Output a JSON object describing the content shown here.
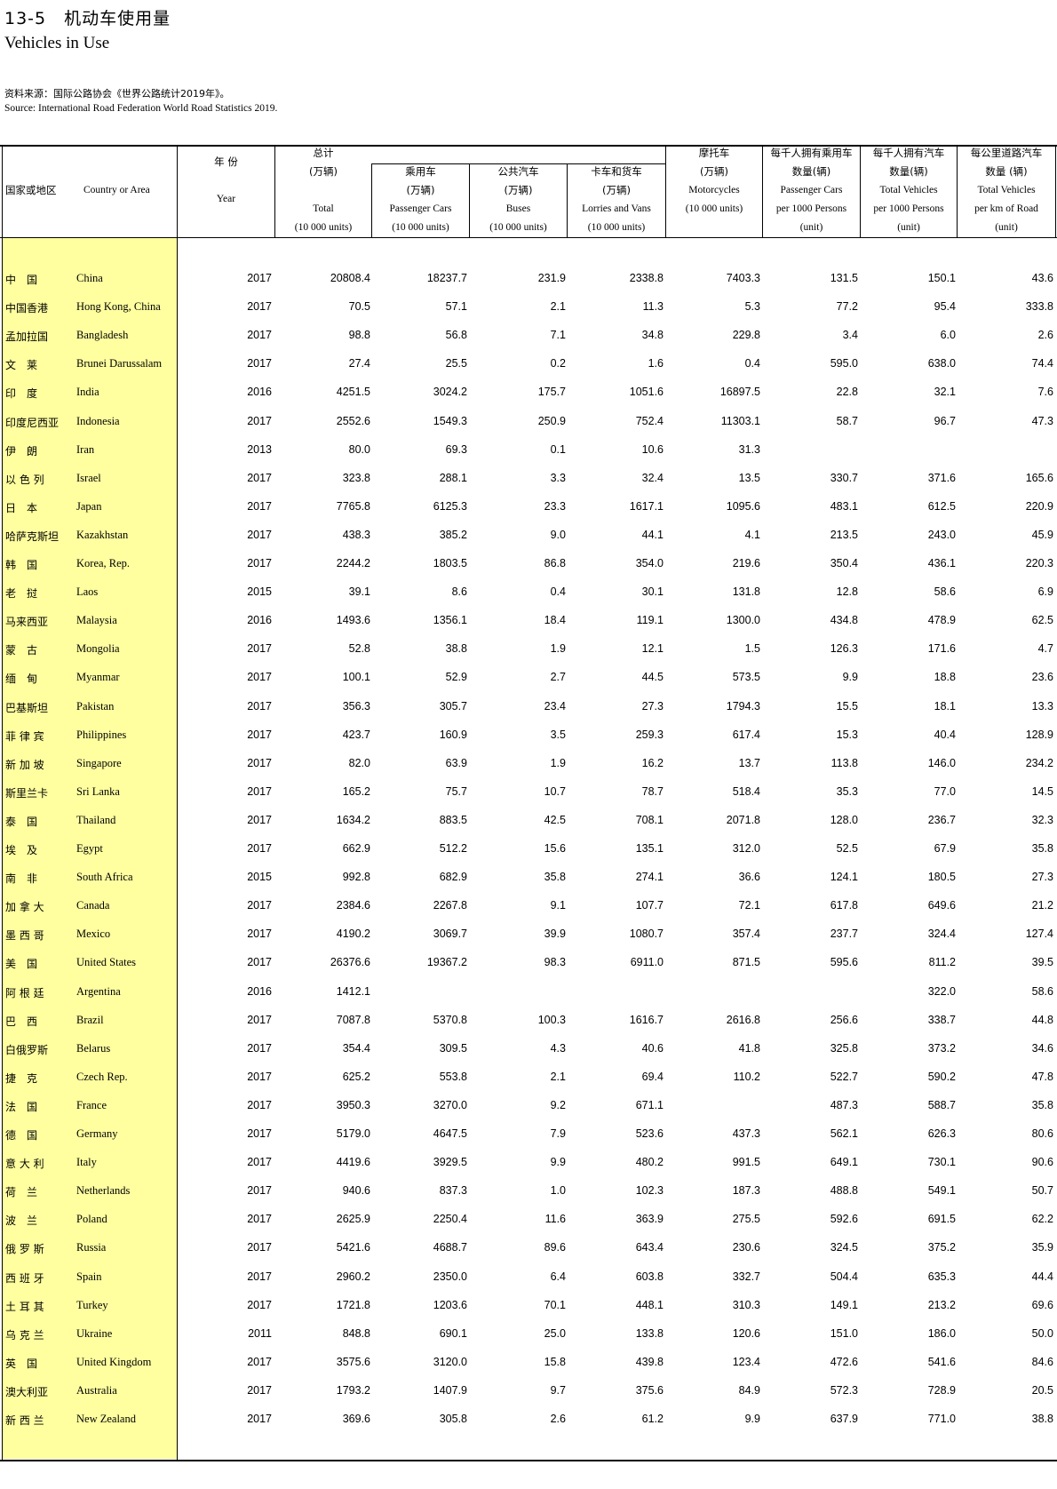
{
  "title_cn": "13-5　机动车使用量",
  "title_en": "Vehicles in Use",
  "source_cn": "资料来源：国际公路协会《世界公路统计2019年》。",
  "source_en": "Source:  International Road Federation World Road Statistics 2019.",
  "headers": {
    "country_cn": "国家或地区",
    "country_en": "Country or Area",
    "year_cn": "年 份",
    "year_en": "Year",
    "total_cn": "总计",
    "total_unit_cn": "(万辆)",
    "total_en": "Total",
    "total_unit_en": "(10 000 units)",
    "pass_cn": "乘用车",
    "pass_unit_cn": "(万辆)",
    "pass_en": "Passenger Cars",
    "pass_unit_en": "(10 000 units)",
    "bus_cn": "公共汽车",
    "bus_unit_cn": "(万辆)",
    "bus_en": "Buses",
    "bus_unit_en": "(10 000 units)",
    "lorry_cn": "卡车和货车",
    "lorry_unit_cn": "(万辆)",
    "lorry_en": "Lorries and Vans",
    "lorry_unit_en": "(10 000 units)",
    "moto_cn": "摩托车",
    "moto_unit_cn": "(万辆)",
    "moto_en": "Motorcycles",
    "moto_unit_en": "(10 000 units)",
    "pcar_cn1": "每千人拥有乘用车",
    "pcar_cn2": "数量(辆)",
    "pcar_en1": "Passenger Cars",
    "pcar_en2": "per 1000 Persons",
    "pcar_unit": "(unit)",
    "tveh_cn1": "每千人拥有汽车",
    "tveh_cn2": "数量(辆)",
    "tveh_en1": "Total Vehicles",
    "tveh_en2": "per 1000 Persons",
    "tveh_unit": "(unit)",
    "perkm_cn1": "每公里道路汽车",
    "perkm_cn2": "数量 (辆)",
    "perkm_en1": "Total Vehicles",
    "perkm_en2": "per km of Road",
    "perkm_unit": "(unit)"
  },
  "rows": [
    {
      "cn": "中　国",
      "en": "China",
      "year": "2017",
      "total": "20808.4",
      "pass": "18237.7",
      "bus": "231.9",
      "lorry": "2338.8",
      "moto": "7403.3",
      "pcar": "131.5",
      "tveh": "150.1",
      "perkm": "43.6"
    },
    {
      "cn": "中国香港",
      "en": "Hong Kong, China",
      "year": "2017",
      "total": "70.5",
      "pass": "57.1",
      "bus": "2.1",
      "lorry": "11.3",
      "moto": "5.3",
      "pcar": "77.2",
      "tveh": "95.4",
      "perkm": "333.8"
    },
    {
      "cn": "孟加拉国",
      "en": "Bangladesh",
      "year": "2017",
      "total": "98.8",
      "pass": "56.8",
      "bus": "7.1",
      "lorry": "34.8",
      "moto": "229.8",
      "pcar": "3.4",
      "tveh": "6.0",
      "perkm": "2.6"
    },
    {
      "cn": "文　莱",
      "en": "Brunei Darussalam",
      "year": "2017",
      "total": "27.4",
      "pass": "25.5",
      "bus": "0.2",
      "lorry": "1.6",
      "moto": "0.4",
      "pcar": "595.0",
      "tveh": "638.0",
      "perkm": "74.4"
    },
    {
      "cn": "印　度",
      "en": "India",
      "year": "2016",
      "total": "4251.5",
      "pass": "3024.2",
      "bus": "175.7",
      "lorry": "1051.6",
      "moto": "16897.5",
      "pcar": "22.8",
      "tveh": "32.1",
      "perkm": "7.6"
    },
    {
      "cn": "印度尼西亚",
      "en": "Indonesia",
      "year": "2017",
      "total": "2552.6",
      "pass": "1549.3",
      "bus": "250.9",
      "lorry": "752.4",
      "moto": "11303.1",
      "pcar": "58.7",
      "tveh": "96.7",
      "perkm": "47.3"
    },
    {
      "cn": "伊　朗",
      "en": "Iran",
      "year": "2013",
      "total": "80.0",
      "pass": "69.3",
      "bus": "0.1",
      "lorry": "10.6",
      "moto": "31.3",
      "pcar": "",
      "tveh": "",
      "perkm": ""
    },
    {
      "cn": "以 色 列",
      "en": "Israel",
      "year": "2017",
      "total": "323.8",
      "pass": "288.1",
      "bus": "3.3",
      "lorry": "32.4",
      "moto": "13.5",
      "pcar": "330.7",
      "tveh": "371.6",
      "perkm": "165.6"
    },
    {
      "cn": "日　本",
      "en": "Japan",
      "year": "2017",
      "total": "7765.8",
      "pass": "6125.3",
      "bus": "23.3",
      "lorry": "1617.1",
      "moto": "1095.6",
      "pcar": "483.1",
      "tveh": "612.5",
      "perkm": "220.9"
    },
    {
      "cn": "哈萨克斯坦",
      "en": "Kazakhstan",
      "year": "2017",
      "total": "438.3",
      "pass": "385.2",
      "bus": "9.0",
      "lorry": "44.1",
      "moto": "4.1",
      "pcar": "213.5",
      "tveh": "243.0",
      "perkm": "45.9"
    },
    {
      "cn": "韩　国",
      "en": "Korea, Rep.",
      "year": "2017",
      "total": "2244.2",
      "pass": "1803.5",
      "bus": "86.8",
      "lorry": "354.0",
      "moto": "219.6",
      "pcar": "350.4",
      "tveh": "436.1",
      "perkm": "220.3"
    },
    {
      "cn": "老　挝",
      "en": "Laos",
      "year": "2015",
      "total": "39.1",
      "pass": "8.6",
      "bus": "0.4",
      "lorry": "30.1",
      "moto": "131.8",
      "pcar": "12.8",
      "tveh": "58.6",
      "perkm": "6.9"
    },
    {
      "cn": "马来西亚",
      "en": "Malaysia",
      "year": "2016",
      "total": "1493.6",
      "pass": "1356.1",
      "bus": "18.4",
      "lorry": "119.1",
      "moto": "1300.0",
      "pcar": "434.8",
      "tveh": "478.9",
      "perkm": "62.5"
    },
    {
      "cn": "蒙　古",
      "en": "Mongolia",
      "year": "2017",
      "total": "52.8",
      "pass": "38.8",
      "bus": "1.9",
      "lorry": "12.1",
      "moto": "1.5",
      "pcar": "126.3",
      "tveh": "171.6",
      "perkm": "4.7"
    },
    {
      "cn": "缅　甸",
      "en": "Myanmar",
      "year": "2017",
      "total": "100.1",
      "pass": "52.9",
      "bus": "2.7",
      "lorry": "44.5",
      "moto": "573.5",
      "pcar": "9.9",
      "tveh": "18.8",
      "perkm": "23.6"
    },
    {
      "cn": "巴基斯坦",
      "en": "Pakistan",
      "year": "2017",
      "total": "356.3",
      "pass": "305.7",
      "bus": "23.4",
      "lorry": "27.3",
      "moto": "1794.3",
      "pcar": "15.5",
      "tveh": "18.1",
      "perkm": "13.3"
    },
    {
      "cn": "菲 律 宾",
      "en": "Philippines",
      "year": "2017",
      "total": "423.7",
      "pass": "160.9",
      "bus": "3.5",
      "lorry": "259.3",
      "moto": "617.4",
      "pcar": "15.3",
      "tveh": "40.4",
      "perkm": "128.9"
    },
    {
      "cn": "新 加 坡",
      "en": "Singapore",
      "year": "2017",
      "total": "82.0",
      "pass": "63.9",
      "bus": "1.9",
      "lorry": "16.2",
      "moto": "13.7",
      "pcar": "113.8",
      "tveh": "146.0",
      "perkm": "234.2"
    },
    {
      "cn": "斯里兰卡",
      "en": "Sri Lanka",
      "year": "2017",
      "total": "165.2",
      "pass": "75.7",
      "bus": "10.7",
      "lorry": "78.7",
      "moto": "518.4",
      "pcar": "35.3",
      "tveh": "77.0",
      "perkm": "14.5"
    },
    {
      "cn": "泰　国",
      "en": "Thailand",
      "year": "2017",
      "total": "1634.2",
      "pass": "883.5",
      "bus": "42.5",
      "lorry": "708.1",
      "moto": "2071.8",
      "pcar": "128.0",
      "tveh": "236.7",
      "perkm": "32.3"
    },
    {
      "cn": "埃　及",
      "en": "Egypt",
      "year": "2017",
      "total": "662.9",
      "pass": "512.2",
      "bus": "15.6",
      "lorry": "135.1",
      "moto": "312.0",
      "pcar": "52.5",
      "tveh": "67.9",
      "perkm": "35.8"
    },
    {
      "cn": "南　非",
      "en": "South Africa",
      "year": "2015",
      "total": "992.8",
      "pass": "682.9",
      "bus": "35.8",
      "lorry": "274.1",
      "moto": "36.6",
      "pcar": "124.1",
      "tveh": "180.5",
      "perkm": "27.3"
    },
    {
      "cn": "加 拿 大",
      "en": "Canada",
      "year": "2017",
      "total": "2384.6",
      "pass": "2267.8",
      "bus": "9.1",
      "lorry": "107.7",
      "moto": "72.1",
      "pcar": "617.8",
      "tveh": "649.6",
      "perkm": "21.2"
    },
    {
      "cn": "墨 西 哥",
      "en": "Mexico",
      "year": "2017",
      "total": "4190.2",
      "pass": "3069.7",
      "bus": "39.9",
      "lorry": "1080.7",
      "moto": "357.4",
      "pcar": "237.7",
      "tveh": "324.4",
      "perkm": "127.4"
    },
    {
      "cn": "美　国",
      "en": "United States",
      "year": "2017",
      "total": "26376.6",
      "pass": "19367.2",
      "bus": "98.3",
      "lorry": "6911.0",
      "moto": "871.5",
      "pcar": "595.6",
      "tveh": "811.2",
      "perkm": "39.5"
    },
    {
      "cn": "阿 根 廷",
      "en": "Argentina",
      "year": "2016",
      "total": "1412.1",
      "pass": "",
      "bus": "",
      "lorry": "",
      "moto": "",
      "pcar": "",
      "tveh": "322.0",
      "perkm": "58.6"
    },
    {
      "cn": "巴　西",
      "en": "Brazil",
      "year": "2017",
      "total": "7087.8",
      "pass": "5370.8",
      "bus": "100.3",
      "lorry": "1616.7",
      "moto": "2616.8",
      "pcar": "256.6",
      "tveh": "338.7",
      "perkm": "44.8"
    },
    {
      "cn": "白俄罗斯",
      "en": "Belarus",
      "year": "2017",
      "total": "354.4",
      "pass": "309.5",
      "bus": "4.3",
      "lorry": "40.6",
      "moto": "41.8",
      "pcar": "325.8",
      "tveh": "373.2",
      "perkm": "34.6"
    },
    {
      "cn": "捷　克",
      "en": "Czech Rep.",
      "year": "2017",
      "total": "625.2",
      "pass": "553.8",
      "bus": "2.1",
      "lorry": "69.4",
      "moto": "110.2",
      "pcar": "522.7",
      "tveh": "590.2",
      "perkm": "47.8"
    },
    {
      "cn": "法　国",
      "en": "France",
      "year": "2017",
      "total": "3950.3",
      "pass": "3270.0",
      "bus": "9.2",
      "lorry": "671.1",
      "moto": "",
      "pcar": "487.3",
      "tveh": "588.7",
      "perkm": "35.8"
    },
    {
      "cn": "德　国",
      "en": "Germany",
      "year": "2017",
      "total": "5179.0",
      "pass": "4647.5",
      "bus": "7.9",
      "lorry": "523.6",
      "moto": "437.3",
      "pcar": "562.1",
      "tveh": "626.3",
      "perkm": "80.6"
    },
    {
      "cn": "意 大 利",
      "en": "Italy",
      "year": "2017",
      "total": "4419.6",
      "pass": "3929.5",
      "bus": "9.9",
      "lorry": "480.2",
      "moto": "991.5",
      "pcar": "649.1",
      "tveh": "730.1",
      "perkm": "90.6"
    },
    {
      "cn": "荷　兰",
      "en": "Netherlands",
      "year": "2017",
      "total": "940.6",
      "pass": "837.3",
      "bus": "1.0",
      "lorry": "102.3",
      "moto": "187.3",
      "pcar": "488.8",
      "tveh": "549.1",
      "perkm": "50.7"
    },
    {
      "cn": "波　兰",
      "en": "Poland",
      "year": "2017",
      "total": "2625.9",
      "pass": "2250.4",
      "bus": "11.6",
      "lorry": "363.9",
      "moto": "275.5",
      "pcar": "592.6",
      "tveh": "691.5",
      "perkm": "62.2"
    },
    {
      "cn": "俄 罗 斯",
      "en": "Russia",
      "year": "2017",
      "total": "5421.6",
      "pass": "4688.7",
      "bus": "89.6",
      "lorry": "643.4",
      "moto": "230.6",
      "pcar": "324.5",
      "tveh": "375.2",
      "perkm": "35.9"
    },
    {
      "cn": "西 班 牙",
      "en": "Spain",
      "year": "2017",
      "total": "2960.2",
      "pass": "2350.0",
      "bus": "6.4",
      "lorry": "603.8",
      "moto": "332.7",
      "pcar": "504.4",
      "tveh": "635.3",
      "perkm": "44.4"
    },
    {
      "cn": "土 耳 其",
      "en": "Turkey",
      "year": "2017",
      "total": "1721.8",
      "pass": "1203.6",
      "bus": "70.1",
      "lorry": "448.1",
      "moto": "310.3",
      "pcar": "149.1",
      "tveh": "213.2",
      "perkm": "69.6"
    },
    {
      "cn": "乌 克 兰",
      "en": "Ukraine",
      "year": "2011",
      "total": "848.8",
      "pass": "690.1",
      "bus": "25.0",
      "lorry": "133.8",
      "moto": "120.6",
      "pcar": "151.0",
      "tveh": "186.0",
      "perkm": "50.0"
    },
    {
      "cn": "英　国",
      "en": "United Kingdom",
      "year": "2017",
      "total": "3575.6",
      "pass": "3120.0",
      "bus": "15.8",
      "lorry": "439.8",
      "moto": "123.4",
      "pcar": "472.6",
      "tveh": "541.6",
      "perkm": "84.6"
    },
    {
      "cn": "澳大利亚",
      "en": "Australia",
      "year": "2017",
      "total": "1793.2",
      "pass": "1407.9",
      "bus": "9.7",
      "lorry": "375.6",
      "moto": "84.9",
      "pcar": "572.3",
      "tveh": "728.9",
      "perkm": "20.5"
    },
    {
      "cn": "新 西 兰",
      "en": "New Zealand",
      "year": "2017",
      "total": "369.6",
      "pass": "305.8",
      "bus": "2.6",
      "lorry": "61.2",
      "moto": "9.9",
      "pcar": "637.9",
      "tveh": "771.0",
      "perkm": "38.8"
    }
  ]
}
